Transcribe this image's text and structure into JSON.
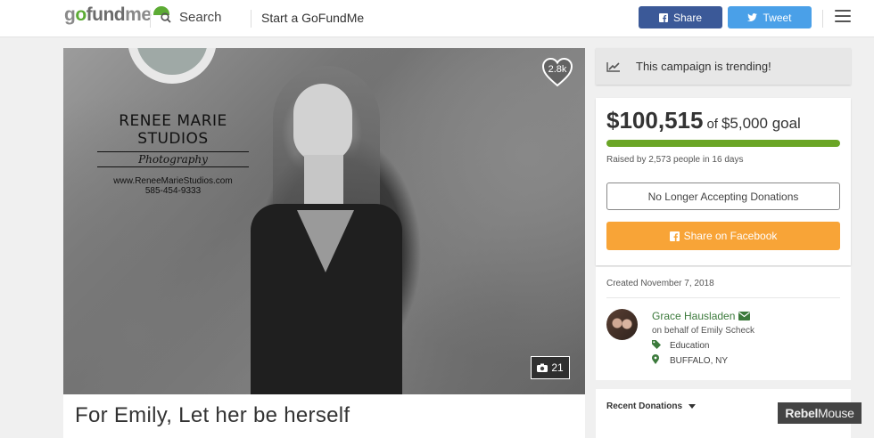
{
  "header": {
    "logo": {
      "a": "g",
      "o": "o",
      "b": "fund",
      "c": "me"
    },
    "search_label": "Search",
    "start_label": "Start a GoFundMe",
    "share_label": "Share",
    "tweet_label": "Tweet"
  },
  "photo": {
    "watermark": {
      "title": "RENEE MARIE STUDIOS",
      "subtitle": "Photography",
      "url": "www.ReneeMarieStudios.com",
      "phone": "585-454-9333"
    },
    "heart_count": "2.8k",
    "photo_count": "21"
  },
  "campaign": {
    "title": "For Emily, Let her be herself"
  },
  "sidebar": {
    "trending_text": "This campaign is trending!",
    "raised_amount": "$100,515",
    "of_text": "of",
    "goal_text": "$5,000 goal",
    "progress_fraction": 1.0,
    "raised_by": "Raised by 2,573 people in 16 days",
    "closed_button": "No Longer Accepting Donations",
    "facebook_button": "Share on Facebook",
    "created": "Created November 7, 2018",
    "organizer_name": "Grace Hausladen",
    "on_behalf": "on behalf of Emily Scheck",
    "category": "Education",
    "location": "BUFFALO, NY",
    "recent_donations": "Recent Donations"
  },
  "badge": {
    "bold": "Rebel",
    "thin": "Mouse"
  },
  "colors": {
    "facebook": "#3b5998",
    "twitter": "#4aa0e8",
    "progress": "#6aa526",
    "cta": "#f8a437",
    "organizer_link": "#3c7a3c"
  },
  "icons": [
    "search-icon",
    "facebook-icon",
    "twitter-icon",
    "menu-icon",
    "trending-icon",
    "heart-icon",
    "camera-icon",
    "envelope-icon",
    "tag-icon",
    "map-marker-icon",
    "caret-down-icon"
  ]
}
